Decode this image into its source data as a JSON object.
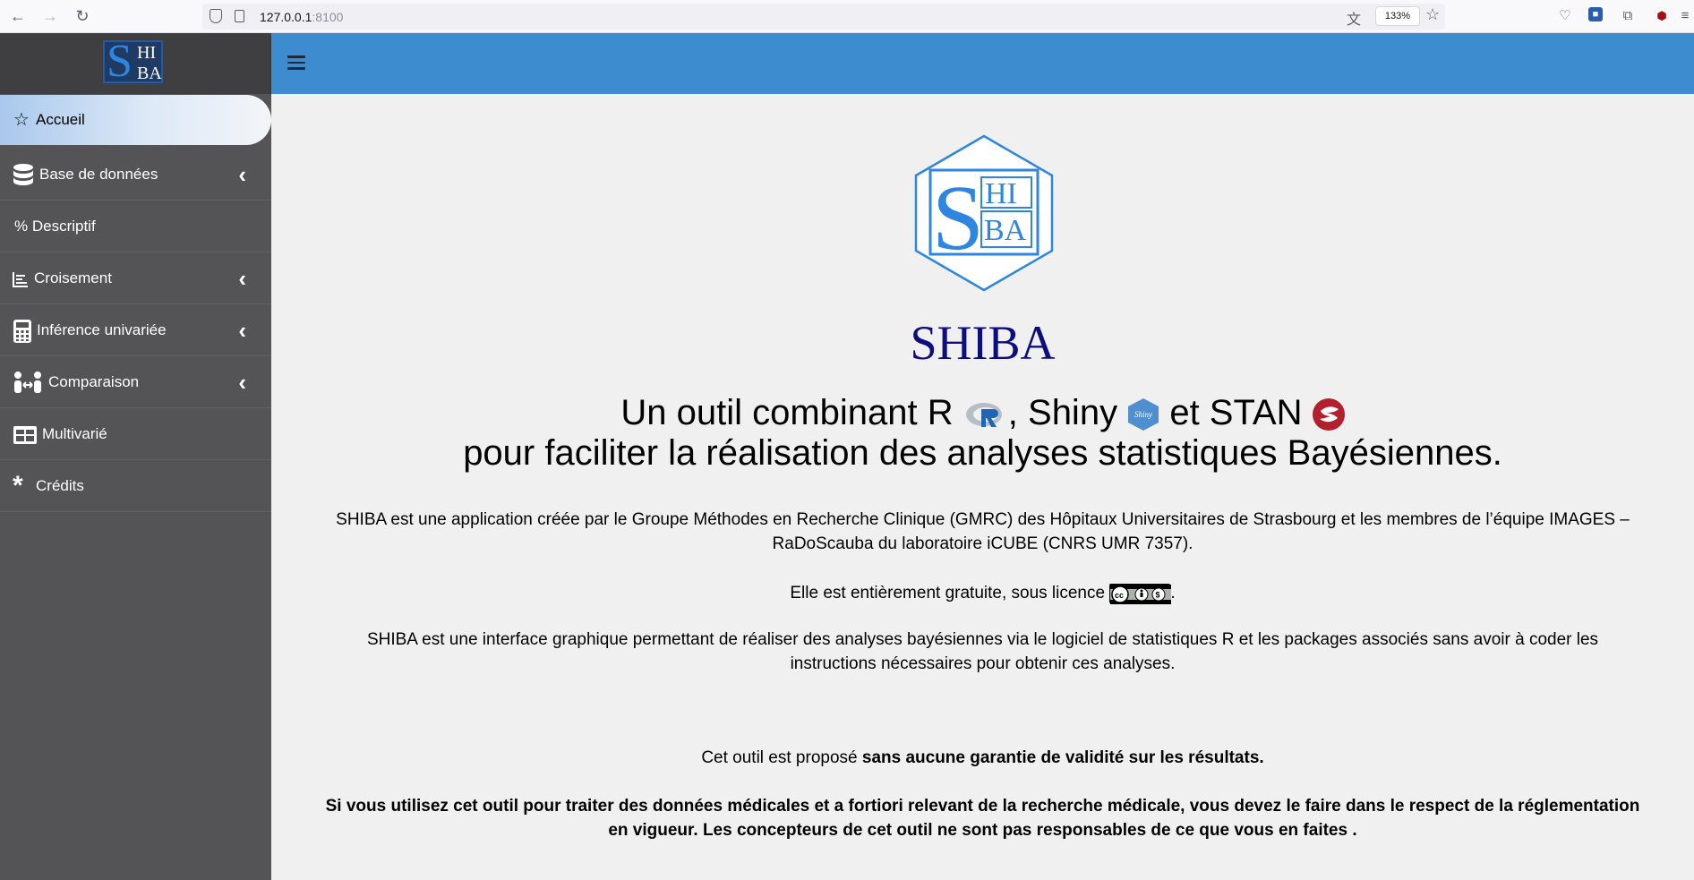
{
  "browser": {
    "url_host": "127.0.0.1",
    "url_port": ":8100",
    "zoom": "133%"
  },
  "sidebar": {
    "brand": {
      "s": "S",
      "hi": "HI",
      "ba": "BA"
    },
    "items": [
      {
        "label": "Accueil",
        "icon": "star-icon"
      },
      {
        "label": "Base de données",
        "icon": "database-icon"
      },
      {
        "label": "% Descriptif",
        "icon": "none"
      },
      {
        "label": "Croisement",
        "icon": "bar-chart-icon"
      },
      {
        "label": "Inférence univariée",
        "icon": "calculator-icon"
      },
      {
        "label": "Comparaison",
        "icon": "people-arrows-icon"
      },
      {
        "label": "Multivarié",
        "icon": "table-icon"
      },
      {
        "label": "Crédits",
        "icon": "asterisk-icon"
      }
    ]
  },
  "main": {
    "logo": {
      "s": "S",
      "hi": "HI",
      "ba": "BA"
    },
    "title": "SHIBA",
    "subtitle_line1_a": "Un outil combinant R",
    "subtitle_line1_b": ", Shiny",
    "subtitle_line1_c": " et STAN",
    "subtitle_line2": "pour faciliter la réalisation des analyses statistiques Bayésiennes.",
    "p1": "SHIBA est une application créée par le Groupe Méthodes en Recherche Clinique (GMRC) des Hôpitaux Universitaires de Strasbourg et les membres de l’équipe IMAGES – RaDoScauba du laboratoire iCUBE (CNRS UMR 7357).",
    "p2_a": "Elle est entièrement gratuite, sous licence ",
    "p2_b": ".",
    "p3": "SHIBA est une interface graphique permettant de réaliser des analyses bayésiennes via le logiciel de statistiques R et les packages associés sans avoir à coder les instructions nécessaires pour obtenir ces analyses.",
    "p4_a": "Cet outil est proposé ",
    "p4_b": "sans aucune garantie de validité sur les résultats.",
    "p5": "Si vous utilisez cet outil pour traiter des données médicales et a fortiori relevant de la recherche médicale, vous devez le faire dans le respect de la réglementation en vigueur. Les concepteurs de cet outil ne sont pas responsables de ce que vous en faites ."
  },
  "colors": {
    "header": "#3c8ccf",
    "sidebar": "#545457",
    "title": "#0d0d80",
    "logo_blue": "#2f86e0"
  }
}
